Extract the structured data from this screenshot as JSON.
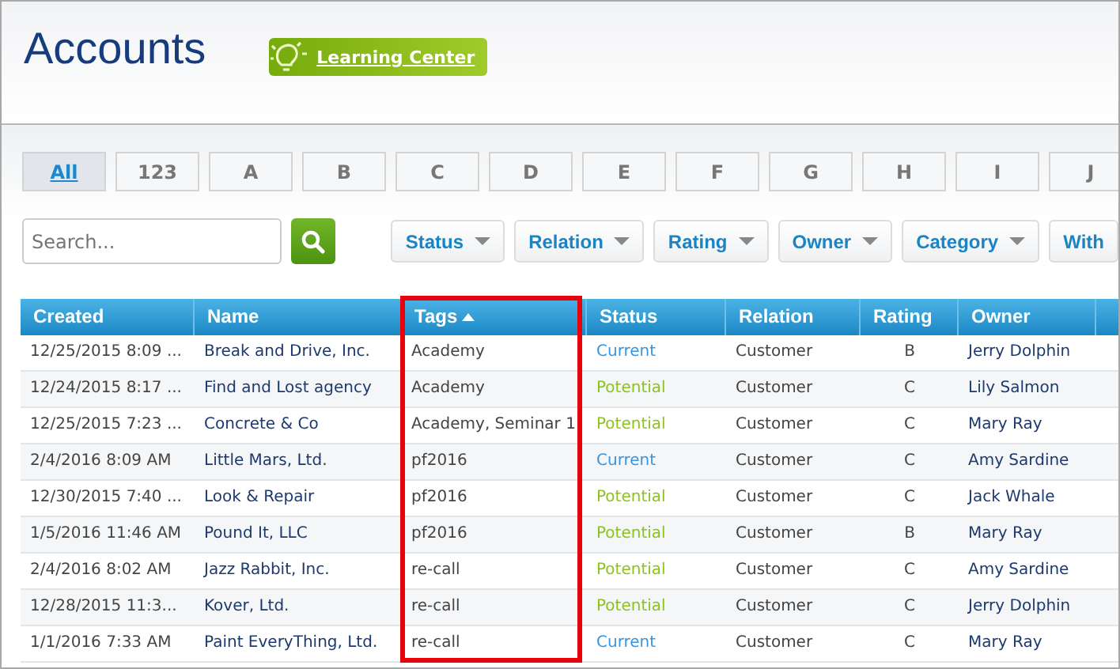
{
  "page": {
    "title": "Accounts",
    "learning_center": "Learning Center"
  },
  "letters": [
    {
      "label": "All",
      "selected": true
    },
    {
      "label": "123",
      "selected": false
    },
    {
      "label": "A",
      "selected": false
    },
    {
      "label": "B",
      "selected": false
    },
    {
      "label": "C",
      "selected": false
    },
    {
      "label": "D",
      "selected": false
    },
    {
      "label": "E",
      "selected": false
    },
    {
      "label": "F",
      "selected": false
    },
    {
      "label": "G",
      "selected": false
    },
    {
      "label": "H",
      "selected": false
    },
    {
      "label": "I",
      "selected": false
    },
    {
      "label": "J",
      "selected": false
    }
  ],
  "search": {
    "placeholder": "Search..."
  },
  "filters": [
    {
      "label": "Status",
      "dropdown": true
    },
    {
      "label": "Relation",
      "dropdown": true
    },
    {
      "label": "Rating",
      "dropdown": true
    },
    {
      "label": "Owner",
      "dropdown": true
    },
    {
      "label": "Category",
      "dropdown": true
    },
    {
      "label": "With",
      "dropdown": false
    }
  ],
  "table": {
    "columns": [
      {
        "label": "Created",
        "sorted": false,
        "highlighted": false
      },
      {
        "label": "Name",
        "sorted": false,
        "highlighted": false
      },
      {
        "label": "Tags",
        "sorted": true,
        "highlighted": true
      },
      {
        "label": "Status",
        "sorted": false,
        "highlighted": false
      },
      {
        "label": "Relation",
        "sorted": false,
        "highlighted": false
      },
      {
        "label": "Rating",
        "sorted": false,
        "highlighted": false
      },
      {
        "label": "Owner",
        "sorted": false,
        "highlighted": false
      }
    ],
    "rows": [
      {
        "created": "12/25/2015 8:09 ...",
        "name": "Break and Drive, Inc.",
        "tags": "Academy",
        "status": "Current",
        "color": "#3a96dd",
        "relation": "Customer",
        "rating": "B",
        "owner": "Jerry Dolphin"
      },
      {
        "created": "12/24/2015 8:17 ...",
        "name": "Find and Lost agency",
        "tags": "Academy",
        "status": "Potential",
        "color": "#8cc31e",
        "relation": "Customer",
        "rating": "C",
        "owner": "Lily Salmon"
      },
      {
        "created": "12/25/2015 7:23 ...",
        "name": "Concrete & Co",
        "tags": "Academy, Seminar 1",
        "status": "Potential",
        "color": "#8cc31e",
        "relation": "Customer",
        "rating": "C",
        "owner": "Mary Ray"
      },
      {
        "created": "2/4/2016 8:09 AM",
        "name": "Little Mars, Ltd.",
        "tags": "pf2016",
        "status": "Current",
        "color": "#3a96dd",
        "relation": "Customer",
        "rating": "C",
        "owner": "Amy Sardine"
      },
      {
        "created": "12/30/2015 7:40 ...",
        "name": "Look & Repair",
        "tags": "pf2016",
        "status": "Potential",
        "color": "#8cc31e",
        "relation": "Customer",
        "rating": "C",
        "owner": "Jack Whale"
      },
      {
        "created": "1/5/2016 11:46 AM",
        "name": "Pound It, LLC",
        "tags": "pf2016",
        "status": "Potential",
        "color": "#8cc31e",
        "relation": "Customer",
        "rating": "B",
        "owner": "Mary Ray"
      },
      {
        "created": "2/4/2016 8:02 AM",
        "name": "Jazz Rabbit, Inc.",
        "tags": "re-call",
        "status": "Potential",
        "color": "#8cc31e",
        "relation": "Customer",
        "rating": "C",
        "owner": "Amy Sardine"
      },
      {
        "created": "12/28/2015 11:3...",
        "name": "Kover, Ltd.",
        "tags": "re-call",
        "status": "Potential",
        "color": "#8cc31e",
        "relation": "Customer",
        "rating": "C",
        "owner": "Jerry Dolphin"
      },
      {
        "created": "1/1/2016 7:33 AM",
        "name": "Paint EveryThing, Ltd.",
        "tags": "re-call",
        "status": "Current",
        "color": "#3a96dd",
        "relation": "Customer",
        "rating": "C",
        "owner": "Mary Ray"
      }
    ]
  }
}
